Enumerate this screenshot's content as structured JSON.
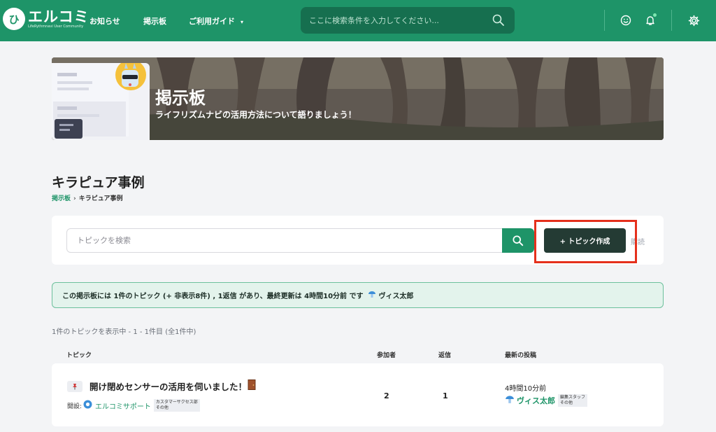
{
  "header": {
    "logo_text": "エルコミ",
    "logo_sub": "LifeRythmnavi User Community",
    "nav": {
      "news": "お知らせ",
      "board": "掲示板",
      "guide": "ご利用ガイド"
    },
    "search_placeholder": "ここに検索条件を入力してください...",
    "icons": [
      "smile-icon",
      "bell-icon",
      "gear-icon"
    ],
    "brand_color": "#1e9468"
  },
  "banner": {
    "title": "掲示板",
    "subtitle": "ライフリズムナビの活用方法について語りましょう！"
  },
  "page": {
    "title": "キラピュア事例",
    "breadcrumb": {
      "parent": "掲示板",
      "separator": "›",
      "current": "キラピュア事例"
    }
  },
  "toolbar": {
    "search_placeholder": "トピックを検索",
    "create_label": "+ トピック作成",
    "subscribe_label": "購読"
  },
  "info": {
    "text": "この掲示板には 1件のトピック (+ 非表示8件) , 1返信 があり、最終更新は 4時間10分前 です",
    "user": "ヴィス太郎"
  },
  "list": {
    "count_text": "1件のトピックを表示中 - 1 - 1件目 (全1件中)",
    "headers": {
      "topic": "トピック",
      "participants": "参加者",
      "replies": "返信",
      "latest": "最新の投稿"
    },
    "rows": [
      {
        "title": "開け閉めセンサーの活用を伺いました！",
        "opened_label": "開設:",
        "author": "エルコミサポート",
        "author_tags": [
          "カスタマーサクセス部",
          "その他"
        ],
        "participants": "2",
        "replies": "1",
        "latest_time": "4時間10分前",
        "latest_user": "ヴィス太郎",
        "latest_tags": [
          "編集スタッフ",
          "その他"
        ]
      }
    ]
  },
  "colors": {
    "accent": "#1e9468",
    "highlight": "#e5301c",
    "create_btn": "#243b34"
  }
}
